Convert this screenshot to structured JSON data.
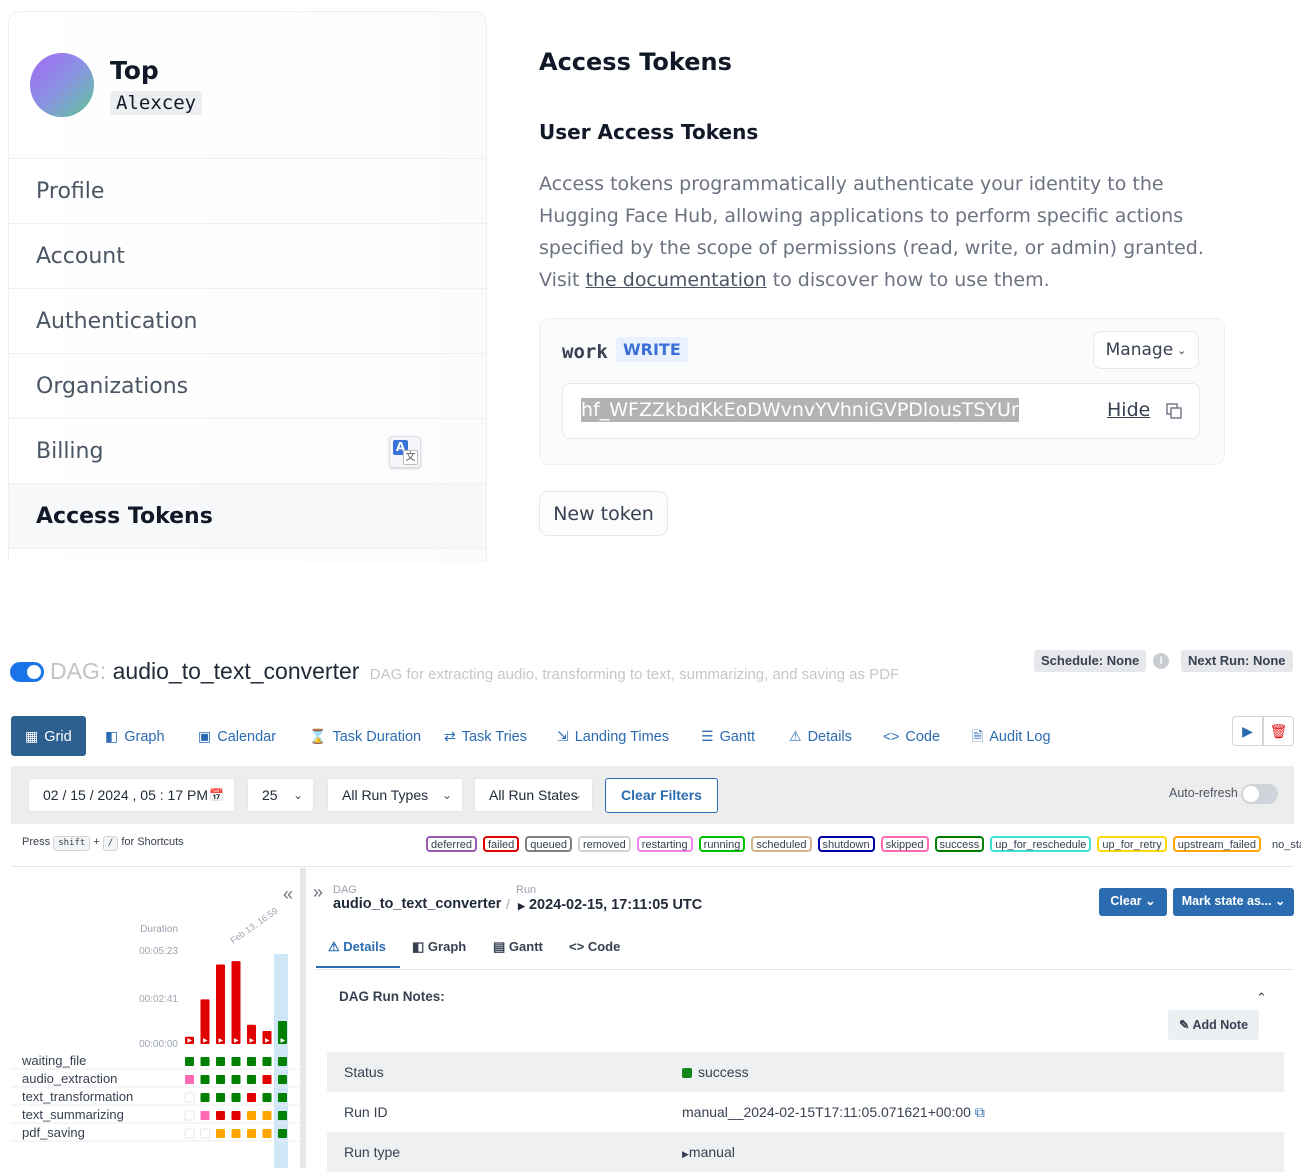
{
  "hf": {
    "user": {
      "name": "Top",
      "username": "Alexcey"
    },
    "nav": [
      {
        "label": "Profile"
      },
      {
        "label": "Account"
      },
      {
        "label": "Authentication"
      },
      {
        "label": "Organizations"
      },
      {
        "label": "Billing"
      },
      {
        "label": "Access Tokens"
      }
    ],
    "page_title": "Access Tokens",
    "section_title": "User Access Tokens",
    "description": "Access tokens programmatically authenticate your identity to the Hugging Face Hub, allowing applications to perform specific actions specified by the scope of permissions (read, write, or admin) granted. Visit ",
    "doc_link": "the documentation",
    "description_end": " to discover how to use them.",
    "token": {
      "name": "work",
      "role": "WRITE",
      "manage_label": "Manage",
      "value": "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",
      "hide_label": "Hide"
    },
    "new_token_label": "New token"
  },
  "airflow": {
    "dag_prefix": "DAG:",
    "dag_id": "audio_to_text_converter",
    "dag_description": "DAG for extracting audio, transforming to text, summarizing, and saving as PDF",
    "schedule": "Schedule: None",
    "next_run": "Next Run: None",
    "tabs": [
      {
        "label": "Grid",
        "icon": "grid-icon"
      },
      {
        "label": "Graph",
        "icon": "graph-icon"
      },
      {
        "label": "Calendar",
        "icon": "calendar-icon"
      },
      {
        "label": "Task Duration",
        "icon": "hourglass-icon"
      },
      {
        "label": "Task Tries",
        "icon": "repeat-icon"
      },
      {
        "label": "Landing Times",
        "icon": "landing-icon"
      },
      {
        "label": "Gantt",
        "icon": "gantt-icon"
      },
      {
        "label": "Details",
        "icon": "warning-triangle-icon"
      },
      {
        "label": "Code",
        "icon": "code-icon"
      },
      {
        "label": "Audit Log",
        "icon": "document-icon"
      }
    ],
    "filters": {
      "date": "02 / 15 / 2024 ,  05 : 17   PM",
      "num_runs": "25",
      "run_types": "All Run Types",
      "run_states": "All Run States",
      "clear_filters": "Clear Filters",
      "auto_refresh": "Auto-refresh"
    },
    "shortcuts": {
      "press": "Press",
      "key1": "shift",
      "plus": "+",
      "key2": "/",
      "suffix": "for Shortcuts"
    },
    "legend": [
      {
        "label": "deferred",
        "color": "#9b59b6"
      },
      {
        "label": "failed",
        "color": "#e00000"
      },
      {
        "label": "queued",
        "color": "#808080"
      },
      {
        "label": "removed",
        "color": "#d3d3d3"
      },
      {
        "label": "restarting",
        "color": "#ee82ee"
      },
      {
        "label": "running",
        "color": "#00c000"
      },
      {
        "label": "scheduled",
        "color": "#d2b48c"
      },
      {
        "label": "shutdown",
        "color": "#0000aa"
      },
      {
        "label": "skipped",
        "color": "#ff69b4"
      },
      {
        "label": "success",
        "color": "#008000"
      },
      {
        "label": "up_for_reschedule",
        "color": "#40e0d0"
      },
      {
        "label": "up_for_retry",
        "color": "#ffd700"
      },
      {
        "label": "upstream_failed",
        "color": "#ffa500"
      },
      {
        "label": "no_status",
        "color": "transparent"
      }
    ],
    "grid": {
      "duration_label": "Duration",
      "date_label": "Feb 13, 16:59",
      "ticks": [
        "00:05:23",
        "00:02:41",
        "00:00:00"
      ],
      "tasks": [
        "waiting_file",
        "audio_extraction",
        "text_transformation",
        "text_summarizing",
        "pdf_saving"
      ]
    },
    "chart_data": {
      "type": "bar",
      "title": "",
      "ylabel": "Duration",
      "yticks": [
        "00:00:00",
        "00:02:41",
        "00:05:23"
      ],
      "ylim_seconds": [
        0,
        323
      ],
      "values_seconds": [
        25,
        155,
        276,
        288,
        67,
        45,
        80
      ],
      "run_states": [
        "failed",
        "failed",
        "failed",
        "failed",
        "failed",
        "failed",
        "success"
      ]
    },
    "details": {
      "dag_label": "DAG",
      "dag_value": "audio_to_text_converter",
      "run_label": "Run",
      "run_value": "2024-02-15, 17:11:05 UTC",
      "clear_btn": "Clear",
      "mark_btn": "Mark state as...",
      "tabs": [
        "Details",
        "Graph",
        "Gantt",
        "Code"
      ],
      "notes_label": "DAG Run Notes:",
      "add_note": "Add Note",
      "rows": [
        {
          "key": "Status",
          "value": "success"
        },
        {
          "key": "Run ID",
          "value": "manual__2024-02-15T17:11:05.071621+00:00"
        },
        {
          "key": "Run type",
          "value": "manual"
        }
      ]
    }
  }
}
